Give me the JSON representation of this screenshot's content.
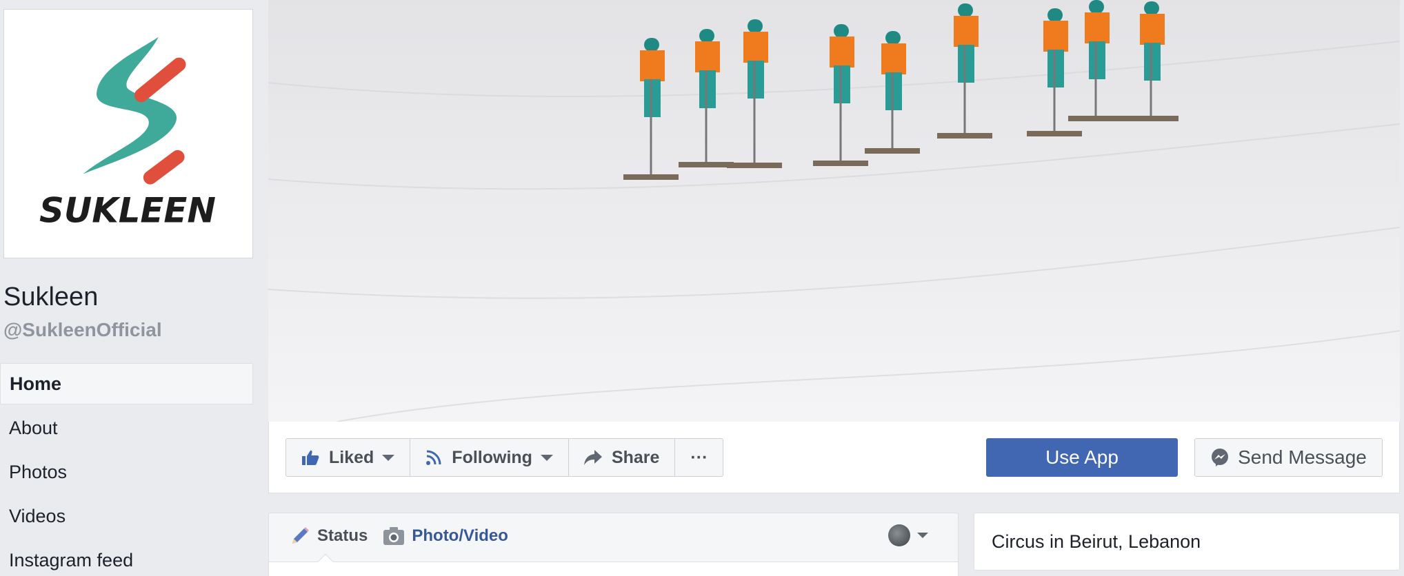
{
  "page": {
    "name": "Sukleen",
    "handle": "@SukleenOfficial",
    "logo_text": "SUKLEEN"
  },
  "sidebar": {
    "items": [
      {
        "label": "Home",
        "active": true
      },
      {
        "label": "About",
        "active": false
      },
      {
        "label": "Photos",
        "active": false
      },
      {
        "label": "Videos",
        "active": false
      },
      {
        "label": "Instagram feed",
        "active": false
      }
    ]
  },
  "actions": {
    "liked_label": "Liked",
    "following_label": "Following",
    "share_label": "Share",
    "more_label": "···",
    "use_app_label": "Use App",
    "send_message_label": "Send Message"
  },
  "composer": {
    "status_label": "Status",
    "photo_video_label": "Photo/Video"
  },
  "location": {
    "text": "Circus in Beirut, Lebanon"
  },
  "colors": {
    "primary": "#4267b2",
    "link": "#365899",
    "logo_teal": "#3fa99a",
    "logo_red": "#e04e3c"
  },
  "icons": [
    "thumbs-up-icon",
    "rss-icon",
    "share-arrow-icon",
    "pencil-icon",
    "camera-icon",
    "messenger-icon"
  ]
}
